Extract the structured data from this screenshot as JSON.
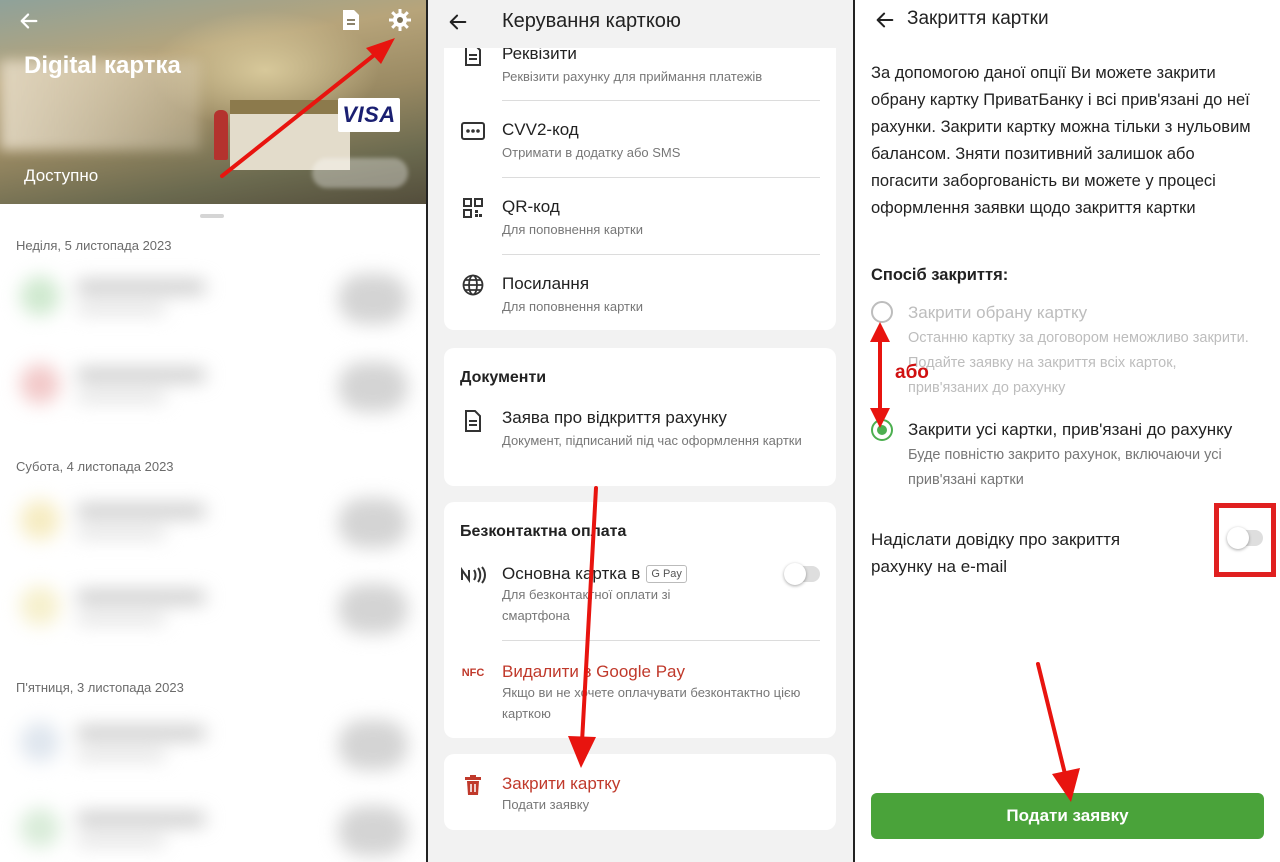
{
  "panel1": {
    "title": "Digital картка",
    "brand": "VISA",
    "available_label": "Доступно",
    "dates": [
      "Неділя, 5 листопада 2023",
      "Субота, 4 листопада 2023",
      "П'ятниця, 3 листопада 2023"
    ],
    "icons": [
      "back-arrow-icon",
      "document-icon",
      "gear-icon"
    ]
  },
  "panel2": {
    "title": "Керування карткою",
    "items": [
      {
        "title": "Реквізити",
        "subtitle": "Реквізити рахунку для приймання платежів"
      },
      {
        "title": "CVV2-код",
        "subtitle": "Отримати в додатку або SMS"
      },
      {
        "title": "QR-код",
        "subtitle": "Для поповнення картки"
      },
      {
        "title": "Посилання",
        "subtitle": "Для поповнення картки"
      }
    ],
    "documents": {
      "heading": "Документи",
      "item_title": "Заява про відкриття рахунку",
      "item_subtitle": "Документ, підписаний під час оформлення картки"
    },
    "contactless": {
      "heading": "Безконтактна оплата",
      "main_title": "Основна картка в",
      "gpay_badge": "G Pay",
      "main_subtitle": "Для безконтактної оплати зі смартфона",
      "remove_icon_label": "NFC",
      "remove_title": "Видалити з Google Pay",
      "remove_subtitle": "Якщо ви не хочете оплачувати безконтактно цією карткою"
    },
    "close": {
      "title": "Закрити картку",
      "subtitle": "Подати заявку"
    }
  },
  "panel3": {
    "title": "Закриття картки",
    "description": "За допомогою даної опції Ви можете закрити обрану картку ПриватБанку і всі прив'язані до неї рахунки. Закрити картку можна тільки з нульовим балансом. Зняти позитивний залишок або погасити заборгованість ви можете у процесі оформлення заявки щодо закриття картки",
    "method_heading": "Спосіб закриття:",
    "option1": {
      "title": "Закрити обрану картку",
      "subtitle": "Останню картку за договором неможливо закрити. Подайте заявку на закриття всіх карток, прив'язаних до рахунку",
      "selected": false
    },
    "option2": {
      "title": "Закрити усі картки, прив'язані до рахунку",
      "subtitle": "Буде повністю закрито рахунок, включаючи усі прив'язані картки",
      "selected": true
    },
    "or_label": "або",
    "email_label": "Надіслати довідку про закриття рахунку на e-mail",
    "email_toggle_on": false,
    "submit_label": "Подати заявку"
  },
  "colors": {
    "accent_green": "#4aa33a",
    "danger_red": "#c0392b",
    "annotation_red": "#e02020"
  }
}
